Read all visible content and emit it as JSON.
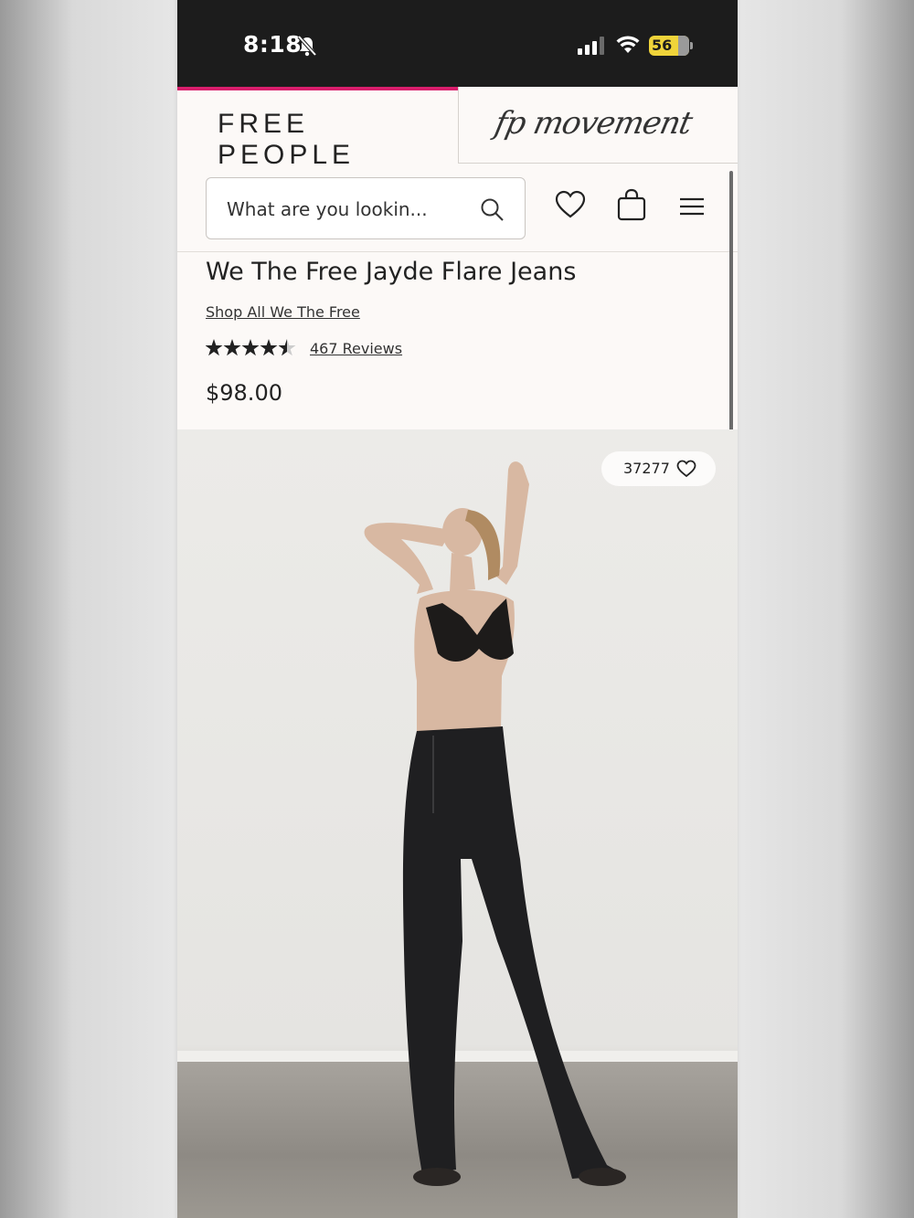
{
  "status_bar": {
    "time": "8:18",
    "battery": "56"
  },
  "brand_tabs": {
    "free_people": "FREE PEOPLE",
    "fp_movement": "fp movement"
  },
  "header": {
    "search_placeholder": "What are you lookin..."
  },
  "product": {
    "title": "We The Free Jayde Flare Jeans",
    "brand_link": "Shop All We The Free",
    "rating": 4.5,
    "reviews": "467 Reviews",
    "price": "$98.00"
  },
  "image": {
    "likes": "37277"
  },
  "colors": {
    "accent": "#d81e6c",
    "background": "#fcf9f7"
  }
}
